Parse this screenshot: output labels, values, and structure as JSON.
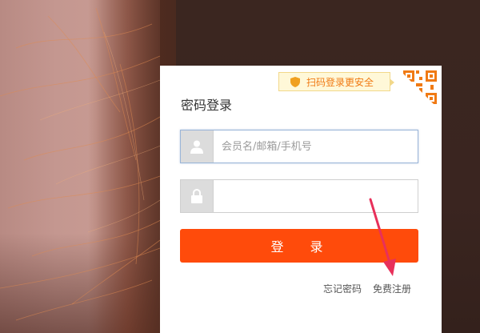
{
  "login": {
    "qr_tip": "扫码登录更安全",
    "title": "密码登录",
    "username_placeholder": "会员名/邮箱/手机号",
    "password_value": "",
    "login_button": "登 录",
    "forgot_password": "忘记密码",
    "register": "免费注册"
  },
  "colors": {
    "accent": "#ff4b0b",
    "tip_text": "#f07a14",
    "tip_bg": "#fff8d8",
    "annotation_arrow": "#e8305a"
  },
  "icons": {
    "shield": "shield-icon",
    "qr_code": "qr-code-icon",
    "user": "user-icon",
    "lock": "lock-icon",
    "arrow": "annotation-arrow"
  }
}
